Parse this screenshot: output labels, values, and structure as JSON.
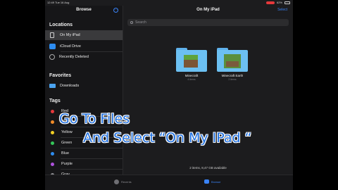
{
  "status_bar": {
    "time": "12:49",
    "date": "Tue 16 Aug",
    "battery": "62%"
  },
  "sidebar": {
    "title": "Browse",
    "locations": {
      "title": "Locations",
      "items": [
        {
          "label": "On My iPad",
          "icon": "ipad-icon",
          "selected": true
        },
        {
          "label": "iCloud Drive",
          "icon": "cloud-icon",
          "selected": false
        },
        {
          "label": "Recently Deleted",
          "icon": "trash-clock-icon",
          "selected": false
        }
      ]
    },
    "favorites": {
      "title": "Favorites",
      "items": [
        {
          "label": "Downloads",
          "icon": "folder-icon"
        }
      ]
    },
    "tags": {
      "title": "Tags",
      "items": [
        {
          "label": "Red",
          "color": "#e5383b"
        },
        {
          "label": "Orange",
          "color": "#f28c28"
        },
        {
          "label": "Yellow",
          "color": "#f2d024"
        },
        {
          "label": "Green",
          "color": "#34c759"
        },
        {
          "label": "Blue",
          "color": "#2d8cf0"
        },
        {
          "label": "Purple",
          "color": "#af52de"
        },
        {
          "label": "Gray",
          "color": "#8e8e93"
        }
      ]
    }
  },
  "main": {
    "title": "On My iPad",
    "select_label": "Select",
    "search_placeholder": "Search",
    "items": [
      {
        "name": "Minecraft",
        "sub": "4 items"
      },
      {
        "name": "Minecraft Earth",
        "sub": "2 items"
      }
    ],
    "footer": "2 items, 8,47 GB available"
  },
  "tabbar": {
    "recents_label": "Recents",
    "browse_label": "Browse"
  },
  "overlay": {
    "line1": "Go To Files",
    "line2": "And Select “On My IPad “"
  },
  "colors": {
    "accent": "#3a83f6",
    "overlay_text": "#1e6fe0"
  }
}
